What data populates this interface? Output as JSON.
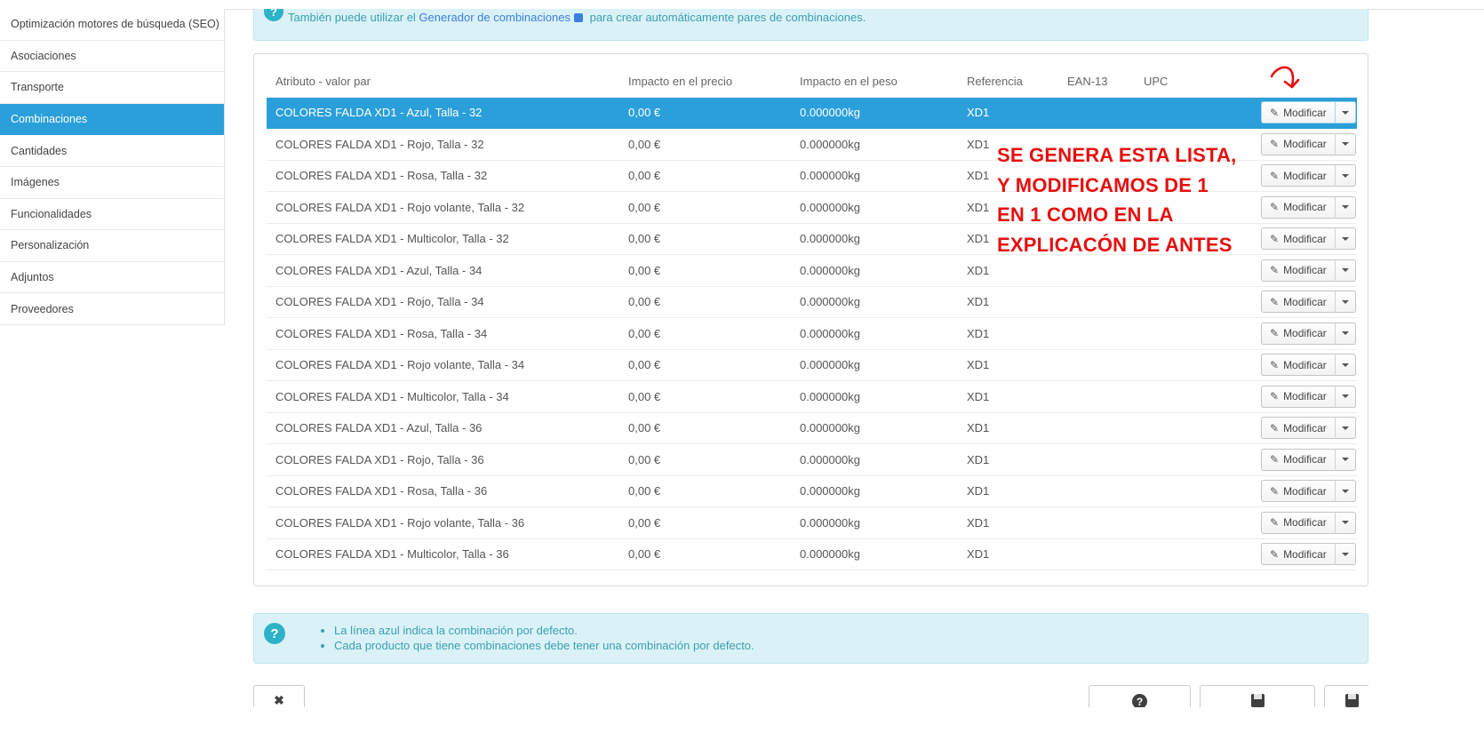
{
  "colors": {
    "accent_blue": "#2b9fd9",
    "annotation_red": "#e60f0f",
    "info_teal": "#2eb2c9",
    "info_bg": "#daf2f7"
  },
  "sidebar": {
    "items": [
      {
        "label": "Optimización motores de búsqueda (SEO)",
        "active": false
      },
      {
        "label": "Asociaciones",
        "active": false
      },
      {
        "label": "Transporte",
        "active": false
      },
      {
        "label": "Combinaciones",
        "active": true
      },
      {
        "label": "Cantidades",
        "active": false
      },
      {
        "label": "Imágenes",
        "active": false
      },
      {
        "label": "Funcionalidades",
        "active": false
      },
      {
        "label": "Personalización",
        "active": false
      },
      {
        "label": "Adjuntos",
        "active": false
      },
      {
        "label": "Proveedores",
        "active": false
      }
    ]
  },
  "top_note": {
    "text_before": "También puede utilizar el ",
    "link": "Generador de combinaciones",
    "text_after": " para crear automáticamente pares de combinaciones."
  },
  "table": {
    "headers": [
      "Atributo - valor par",
      "Impacto en el precio",
      "Impacto en el peso",
      "Referencia",
      "EAN-13",
      "UPC"
    ],
    "action_label": "Modificar",
    "rows": [
      {
        "attr": "COLORES FALDA XD1 - Azul, Talla - 32",
        "price": "0,00 €",
        "weight": "0.000000kg",
        "ref": "XD1",
        "ean13": "",
        "upc": "",
        "default": true
      },
      {
        "attr": "COLORES FALDA XD1 - Rojo, Talla - 32",
        "price": "0,00 €",
        "weight": "0.000000kg",
        "ref": "XD1",
        "ean13": "",
        "upc": "",
        "default": false
      },
      {
        "attr": "COLORES FALDA XD1 - Rosa, Talla - 32",
        "price": "0,00 €",
        "weight": "0.000000kg",
        "ref": "XD1",
        "ean13": "",
        "upc": "",
        "default": false
      },
      {
        "attr": "COLORES FALDA XD1 - Rojo volante, Talla - 32",
        "price": "0,00 €",
        "weight": "0.000000kg",
        "ref": "XD1",
        "ean13": "",
        "upc": "",
        "default": false
      },
      {
        "attr": "COLORES FALDA XD1 - Multicolor, Talla - 32",
        "price": "0,00 €",
        "weight": "0.000000kg",
        "ref": "XD1",
        "ean13": "",
        "upc": "",
        "default": false
      },
      {
        "attr": "COLORES FALDA XD1 - Azul, Talla - 34",
        "price": "0,00 €",
        "weight": "0.000000kg",
        "ref": "XD1",
        "ean13": "",
        "upc": "",
        "default": false
      },
      {
        "attr": "COLORES FALDA XD1 - Rojo, Talla - 34",
        "price": "0,00 €",
        "weight": "0.000000kg",
        "ref": "XD1",
        "ean13": "",
        "upc": "",
        "default": false
      },
      {
        "attr": "COLORES FALDA XD1 - Rosa, Talla - 34",
        "price": "0,00 €",
        "weight": "0.000000kg",
        "ref": "XD1",
        "ean13": "",
        "upc": "",
        "default": false
      },
      {
        "attr": "COLORES FALDA XD1 - Rojo volante, Talla - 34",
        "price": "0,00 €",
        "weight": "0.000000kg",
        "ref": "XD1",
        "ean13": "",
        "upc": "",
        "default": false
      },
      {
        "attr": "COLORES FALDA XD1 - Multicolor, Talla - 34",
        "price": "0,00 €",
        "weight": "0.000000kg",
        "ref": "XD1",
        "ean13": "",
        "upc": "",
        "default": false
      },
      {
        "attr": "COLORES FALDA XD1 - Azul, Talla - 36",
        "price": "0,00 €",
        "weight": "0.000000kg",
        "ref": "XD1",
        "ean13": "",
        "upc": "",
        "default": false
      },
      {
        "attr": "COLORES FALDA XD1 - Rojo, Talla - 36",
        "price": "0,00 €",
        "weight": "0.000000kg",
        "ref": "XD1",
        "ean13": "",
        "upc": "",
        "default": false
      },
      {
        "attr": "COLORES FALDA XD1 - Rosa, Talla - 36",
        "price": "0,00 €",
        "weight": "0.000000kg",
        "ref": "XD1",
        "ean13": "",
        "upc": "",
        "default": false
      },
      {
        "attr": "COLORES FALDA XD1 - Rojo volante, Talla - 36",
        "price": "0,00 €",
        "weight": "0.000000kg",
        "ref": "XD1",
        "ean13": "",
        "upc": "",
        "default": false
      },
      {
        "attr": "COLORES FALDA XD1 - Multicolor, Talla - 36",
        "price": "0,00 €",
        "weight": "0.000000kg",
        "ref": "XD1",
        "ean13": "",
        "upc": "",
        "default": false
      }
    ]
  },
  "annotation": {
    "lines": [
      "SE GENERA ESTA LISTA,",
      "Y MODIFICAMOS DE 1",
      "EN 1 COMO EN LA",
      "EXPLICACÓN DE ANTES"
    ]
  },
  "bottom_note": {
    "bullets": [
      "La línea azul indica la combinación por defecto.",
      "Cada producto que tiene combinaciones debe tener una combinación por defecto."
    ]
  },
  "help_icon_glyph": "?"
}
